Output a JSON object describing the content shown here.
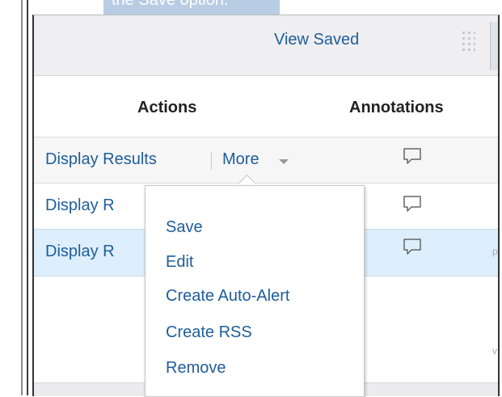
{
  "top_snippet": "the Save option.",
  "header": {
    "view_saved_label": "View Saved"
  },
  "columns": {
    "actions": "Actions",
    "annotations": "Annotations"
  },
  "rows": [
    {
      "display_label": "Display Results",
      "more_label": "More"
    },
    {
      "display_label": "Display R"
    },
    {
      "display_label": "Display R"
    }
  ],
  "edge_chars": {
    "row3": "p",
    "lower": "v"
  },
  "menu": {
    "items": [
      "Save",
      "Edit",
      "Create Auto-Alert",
      "Create RSS",
      "Remove"
    ]
  },
  "icons": {
    "annotation": "comment-icon",
    "more_dropdown": "caret-down-icon",
    "drag_handle": "grip-icon"
  },
  "colors": {
    "link": "#1f5d9a",
    "header_bg": "#efeff1",
    "selected_row_bg": "#ddeefc"
  }
}
